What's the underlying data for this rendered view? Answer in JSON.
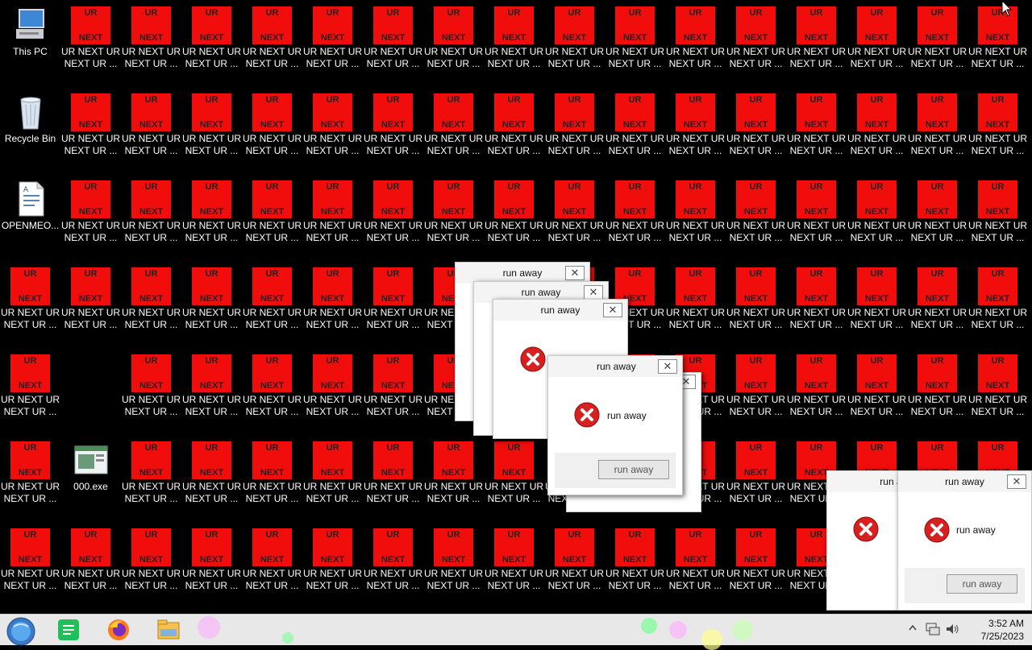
{
  "desktop": {
    "system_icons": [
      {
        "id": "this-pc",
        "label": "This PC"
      },
      {
        "id": "recycle-bin",
        "label": "Recycle Bin"
      },
      {
        "id": "openmeo",
        "label": "OPENMEO..."
      },
      {
        "id": "000-exe",
        "label": "000.exe"
      }
    ],
    "ur_icon": {
      "tile_top": "UR",
      "tile_bottom": "NEXT",
      "label_line1": "UR NEXT UR",
      "label_line2": "NEXT UR ..."
    }
  },
  "dialogs": [
    {
      "title": "run away",
      "message": "run away",
      "button": "run away",
      "close": "✕"
    }
  ],
  "taskbar": {
    "time": "3:52 AM",
    "date": "7/25/2023"
  },
  "colors": {
    "tile_red": "#f20d0d",
    "desktop_bg": "#000000",
    "taskbar_bg": "#e8e8e8"
  }
}
